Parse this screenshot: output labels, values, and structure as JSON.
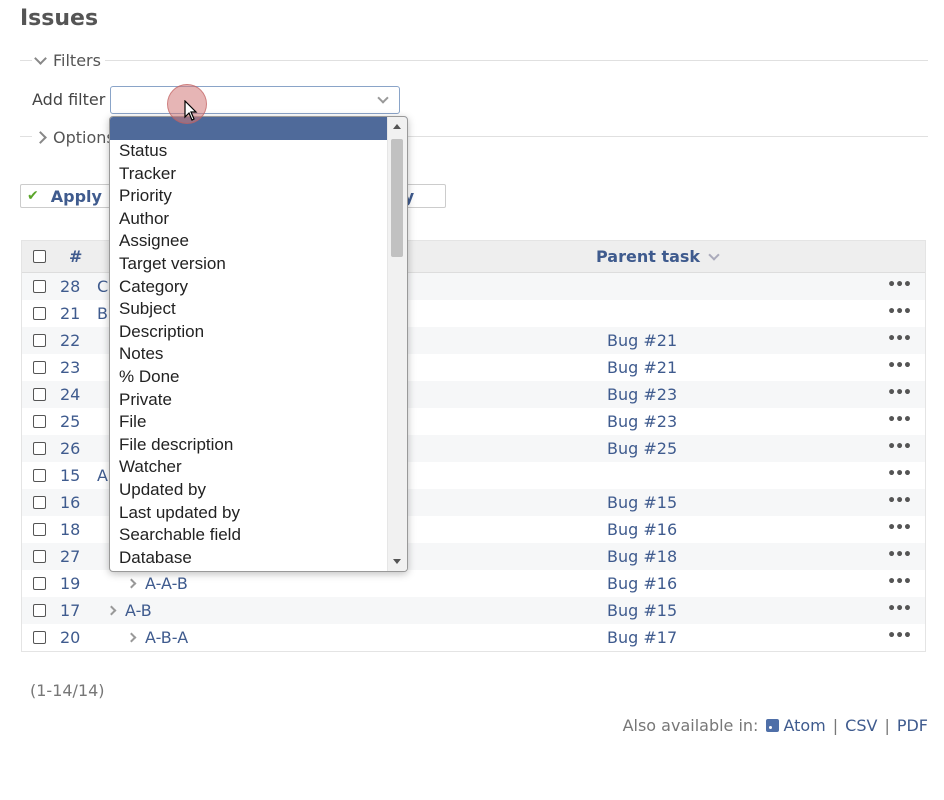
{
  "page": {
    "title": "Issues"
  },
  "filters": {
    "legend": "Filters",
    "add_filter_label": "Add filter",
    "options": [
      "",
      "Status",
      "Tracker",
      "Priority",
      "Author",
      "Assignee",
      "Target version",
      "Category",
      "Subject",
      "Description",
      "Notes",
      "% Done",
      "Private",
      "File",
      "File description",
      "Watcher",
      "Updated by",
      "Last updated by",
      "Searchable field",
      "Database"
    ]
  },
  "options_section": {
    "legend": "Options"
  },
  "buttons": {
    "apply": "Apply",
    "save_fragment": "ery"
  },
  "table": {
    "headers": {
      "id": "#",
      "parent": "Parent task"
    },
    "rows": [
      {
        "id": "28",
        "subject": "C",
        "parent": "",
        "indent": 0,
        "chevron": false
      },
      {
        "id": "21",
        "subject": "B",
        "parent": "",
        "indent": 0,
        "chevron": false
      },
      {
        "id": "22",
        "subject": "",
        "parent": "Bug #21",
        "indent": 1,
        "chevron": false
      },
      {
        "id": "23",
        "subject": "",
        "parent": "Bug #21",
        "indent": 1,
        "chevron": false
      },
      {
        "id": "24",
        "subject": "",
        "parent": "Bug #23",
        "indent": 2,
        "chevron": false
      },
      {
        "id": "25",
        "subject": "",
        "parent": "Bug #23",
        "indent": 2,
        "chevron": false
      },
      {
        "id": "26",
        "subject": "",
        "parent": "Bug #25",
        "indent": 3,
        "chevron": false
      },
      {
        "id": "15",
        "subject": "A",
        "parent": "",
        "indent": 0,
        "chevron": false
      },
      {
        "id": "16",
        "subject": "",
        "parent": "Bug #15",
        "indent": 1,
        "chevron": false
      },
      {
        "id": "18",
        "subject": "",
        "parent": "Bug #16",
        "indent": 2,
        "chevron": false
      },
      {
        "id": "27",
        "subject": "",
        "parent": "Bug #18",
        "indent": 3,
        "chevron": false
      },
      {
        "id": "19",
        "subject": "A-A-B",
        "parent": "Bug #16",
        "indent": 2,
        "chevron": true
      },
      {
        "id": "17",
        "subject": "A-B",
        "parent": "Bug #15",
        "indent": 1,
        "chevron": true
      },
      {
        "id": "20",
        "subject": "A-B-A",
        "parent": "Bug #17",
        "indent": 2,
        "chevron": true
      }
    ],
    "more_label": "•••"
  },
  "pagination": {
    "text": "(1-14/14)"
  },
  "other_formats": {
    "label": "Also available in:",
    "atom": "Atom",
    "csv": "CSV",
    "pdf": "PDF",
    "separator": "|"
  },
  "colors": {
    "link": "#3f5b8e",
    "selected_option": "#4f6a9a",
    "apply_check": "#5aa52a"
  }
}
